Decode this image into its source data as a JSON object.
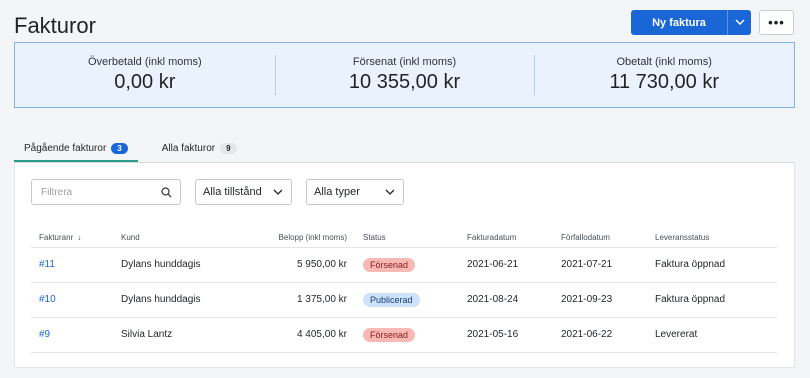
{
  "header": {
    "title": "Fakturor",
    "new_invoice_label": "Ny faktura",
    "more_label": "•••"
  },
  "summary": [
    {
      "label": "Överbetald (inkl moms)",
      "value": "0,00 kr"
    },
    {
      "label": "Försenat (inkl moms)",
      "value": "10 355,00 kr"
    },
    {
      "label": "Obetalt (inkl moms)",
      "value": "11 730,00 kr"
    }
  ],
  "tabs": [
    {
      "label": "Pågående fakturor",
      "count": "3",
      "active": true
    },
    {
      "label": "Alla fakturor",
      "count": "9",
      "active": false
    }
  ],
  "filters": {
    "search_placeholder": "Filtrera",
    "state_select": "Alla tillstånd",
    "type_select": "Alla typer"
  },
  "table": {
    "headers": {
      "number": "Fakturanr",
      "customer": "Kund",
      "amount": "Belopp (inkl moms)",
      "status": "Status",
      "invoice_date": "Fakturadatum",
      "due_date": "Förfallodatum",
      "delivery": "Leveransstatus"
    },
    "sort_indicator": "↓",
    "rows": [
      {
        "number": "#11",
        "customer": "Dylans hunddagis",
        "amount": "5 950,00 kr",
        "status": "Försenad",
        "invoice_date": "2021-06-21",
        "due_date": "2021-07-21",
        "delivery": "Faktura öppnad"
      },
      {
        "number": "#10",
        "customer": "Dylans hunddagis",
        "amount": "1 375,00 kr",
        "status": "Publicerad",
        "invoice_date": "2021-08-24",
        "due_date": "2021-09-23",
        "delivery": "Faktura öppnad"
      },
      {
        "number": "#9",
        "customer": "Silvia Lantz",
        "amount": "4 405,00 kr",
        "status": "Försenad",
        "invoice_date": "2021-05-16",
        "due_date": "2021-06-22",
        "delivery": "Levererat"
      }
    ]
  },
  "colors": {
    "primary": "#1a66d6",
    "overdue_badge": "#f6b9b6",
    "published_badge": "#cfe2fb",
    "active_tab_underline": "#2b9c8a"
  }
}
